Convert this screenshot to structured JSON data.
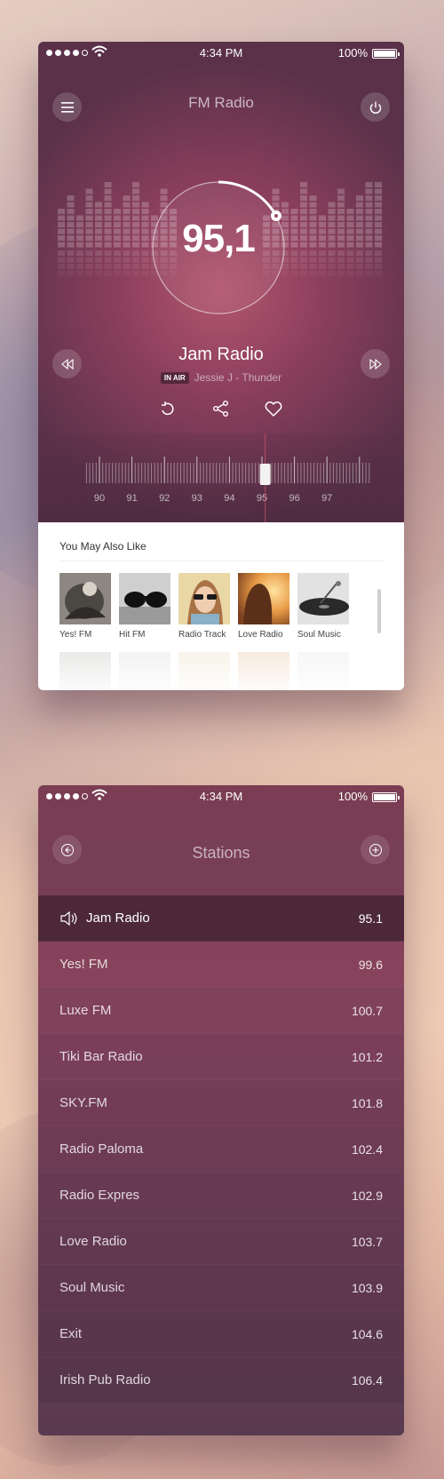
{
  "status": {
    "time": "4:34 PM",
    "battery": "100%"
  },
  "player": {
    "title": "FM Radio",
    "frequency": "95,1",
    "station": "Jam Radio",
    "badge": "IN AIR",
    "track": "Jessie J - Thunder",
    "tuner_ticks": [
      "90",
      "91",
      "92",
      "93",
      "94",
      "95",
      "96",
      "97"
    ],
    "tuner_position": 95.1
  },
  "you_may_also_like": {
    "title": "You May Also Like",
    "items": [
      {
        "label": "Yes! FM",
        "icon": "photo-woman-bw"
      },
      {
        "label": "Hit FM",
        "icon": "photo-sunglasses"
      },
      {
        "label": "Radio Track",
        "icon": "photo-girl-sunglasses"
      },
      {
        "label": "Love Radio",
        "icon": "photo-sunset-girl"
      },
      {
        "label": "Soul Music",
        "icon": "photo-turntable"
      }
    ]
  },
  "stations": {
    "title": "Stations",
    "list": [
      {
        "name": "Jam Radio",
        "freq": "95.1",
        "active": true
      },
      {
        "name": "Yes! FM",
        "freq": "99.6"
      },
      {
        "name": "Luxe FM",
        "freq": "100.7"
      },
      {
        "name": "Tiki Bar Radio",
        "freq": "101.2"
      },
      {
        "name": "SKY.FM",
        "freq": "101.8"
      },
      {
        "name": "Radio Paloma",
        "freq": "102.4"
      },
      {
        "name": "Radio Expres",
        "freq": "102.9"
      },
      {
        "name": "Love Radio",
        "freq": "103.7"
      },
      {
        "name": "Soul Music",
        "freq": "103.9"
      },
      {
        "name": "Exit",
        "freq": "104.6"
      },
      {
        "name": "Irish Pub Radio",
        "freq": "106.4"
      }
    ]
  },
  "colors": {
    "accent": "#b35670",
    "dark": "#4c2838",
    "list_bg": "#73415a"
  }
}
